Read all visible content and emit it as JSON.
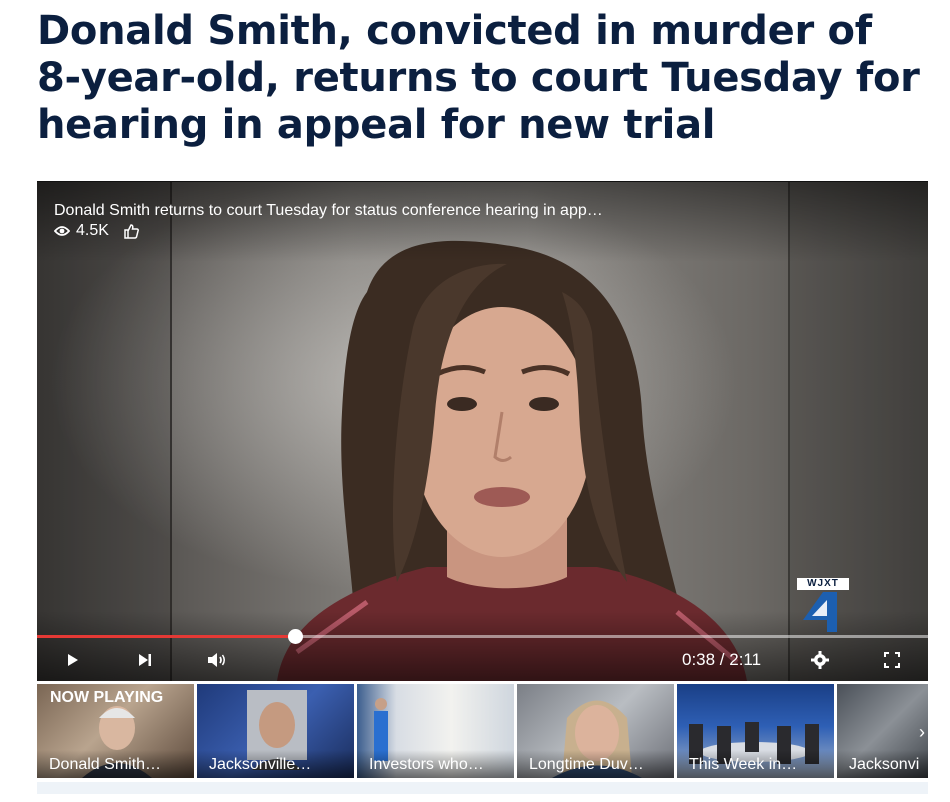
{
  "article": {
    "headline": "Donald Smith, convicted in murder of 8-year-old, returns to court Tuesday for hearing in appeal for new trial"
  },
  "player": {
    "video_title": "Donald Smith returns to court Tuesday for status conference hearing in app…",
    "views": "4.5K",
    "time_display": "0:38 / 2:11",
    "progress": 0.29,
    "station_logo": "WJXT",
    "station_number": "4",
    "accent_color": "#e53935",
    "icons": [
      "eye-icon",
      "thumbs-up-icon",
      "play-icon",
      "next-icon",
      "volume-icon",
      "settings-icon",
      "fullscreen-icon"
    ]
  },
  "playlist": {
    "now_playing_label": "NOW PLAYING",
    "items": [
      {
        "label": "Donald Smith…"
      },
      {
        "label": "Jacksonville…"
      },
      {
        "label": "Investors who…"
      },
      {
        "label": "Longtime Duv…"
      },
      {
        "label": "This Week in…"
      },
      {
        "label": "Jacksonvi"
      }
    ]
  }
}
